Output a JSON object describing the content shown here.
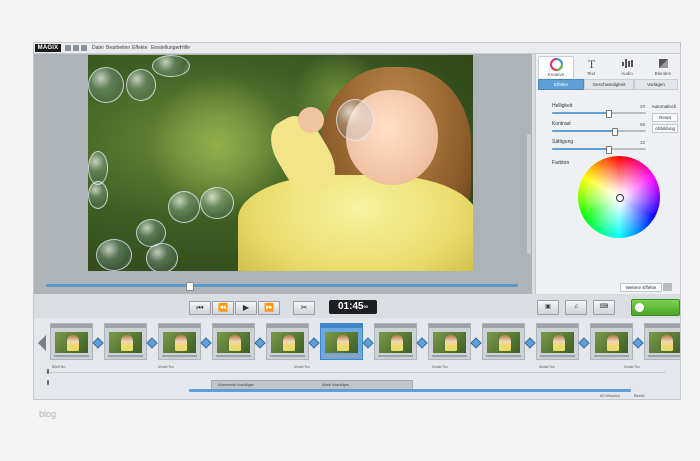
{
  "app": {
    "logo": "MAGIX",
    "menu": [
      "Datei",
      "Bearbeiten",
      "Effekte",
      "Einstellungen",
      "Hilfe"
    ]
  },
  "panel": {
    "tabs": [
      {
        "label": "Kreative",
        "icon": "color-wheel-icon",
        "active": true
      },
      {
        "label": "Text",
        "icon": "text-icon",
        "active": false
      },
      {
        "label": "Audio",
        "icon": "audio-icon",
        "active": false
      },
      {
        "label": "Blenden",
        "icon": "transition-icon",
        "active": false
      }
    ],
    "subtabs": [
      "Effekte",
      "Geschwindigkeit",
      "Vorlagen"
    ],
    "sliders": [
      {
        "label": "Helligkeit",
        "value": "20",
        "level": 0.6
      },
      {
        "label": "Kontrast",
        "value": "56",
        "level": 0.66
      },
      {
        "label": "Sättigung",
        "value": "32",
        "level": 0.6
      }
    ],
    "buttons": [
      "Automatisch",
      "Reset",
      "Abbildung"
    ],
    "color_label": "Farbton",
    "bottom_button": "Weitere Effekte"
  },
  "controls": {
    "timecode": "01:45",
    "timecode_frames": "00"
  },
  "timeline": {
    "clips": 12,
    "active_clip": 5,
    "track_labels": [
      "Bild/Film",
      "Musik/Ton",
      "Musik/Ton",
      "Musik/Ton",
      "Musik/Ton",
      "Musik/Ton"
    ],
    "audio_labels": [
      "Kommentar hinzufügen",
      "Musik hinzufügen"
    ],
    "status_left": "00 Minuten",
    "status_right": "Bereit"
  },
  "watermark": "blog",
  "colors": {
    "accent": "#5d9fd6",
    "green_action": "#4aa52a",
    "timecode_bg": "#1d1f22"
  }
}
